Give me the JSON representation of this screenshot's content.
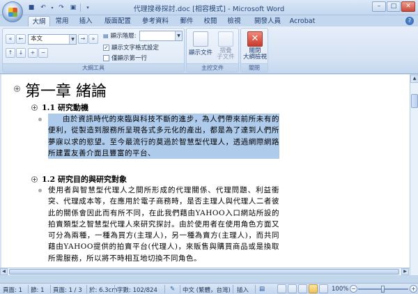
{
  "window": {
    "title": "代理搜尋探討.doc [相容模式] - Microsoft Word",
    "minimize": "–",
    "maximize": "□",
    "close": "✕"
  },
  "qat": [
    "save-icon",
    "undo-icon",
    "redo-icon",
    "customize-icon"
  ],
  "tabs": [
    "大綱",
    "常用",
    "插入",
    "版面配置",
    "參考資料",
    "郵件",
    "校閱",
    "檢視",
    "開發人員",
    "Acrobat"
  ],
  "active_tab": "大綱",
  "ribbon": {
    "outline_tools": {
      "level_value": "本文",
      "show_level_label": "顯示階層:",
      "show_level_value": "",
      "show_text_format": "顯示文字格式設定",
      "show_text_format_checked": true,
      "show_first_line_only": "僅顯示第一行",
      "show_first_line_only_checked": false,
      "group_label": "大綱工具"
    },
    "master_document": {
      "show_document": "顯示文件",
      "collapse_subdocs": "摺疊\n子文件",
      "group_label": "主控文件"
    },
    "close": {
      "close_outline": "關閉\n大綱檢視",
      "group_label": "關閉"
    }
  },
  "document": {
    "chapter_title": "第一章  緒論",
    "sections": [
      {
        "heading": "1.1  研究動機",
        "paragraph": "由於資訊時代的來臨與科技不斷的進步，為人們帶來前所未有的便利，從製造到服務所呈現各式多元化的產出，都是為了達到人們所夢寐以求的慾望。至今最流行的莫過於智慧型代理人，透過網際網路所建置友善介面且豐富的平台、"
      },
      {
        "heading": "1.2  研究目的與研究對象",
        "paragraph": "使用者與智慧型代理人之間所形成的代理關係、代理問題、利益衝突、代理成本等，在應用於電子商務時，是否主理人與代理人二者彼此的關係會因此而有所不同，在此我們藉由YAHOO入口網站所設的拍賣類型之智慧型代理人來研究探討。由於使用者在使用角色方面又可分為兩種，一種為買方(主理人)，另一種為賣方(主理人)，而共同藉由YAHOO提供的拍賣平台(代理人)，來販售與購買商品或是換取所需服務，所以將不時相互地切換不同角色。"
      }
    ]
  },
  "status": {
    "page": "頁面: 1",
    "section": "節: 1",
    "page_of": "頁面: 1 / 3",
    "position": "於: 6.3cm",
    "words": "字數: 102/824",
    "language": "中文 (繁體，台灣)",
    "insert_mode": "插入",
    "zoom": "100%"
  }
}
